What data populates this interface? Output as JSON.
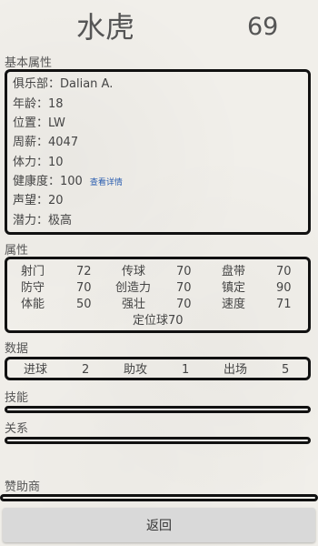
{
  "header": {
    "name": "水虎",
    "rating": "69"
  },
  "basic": {
    "title": "基本属性",
    "club": "俱乐部：Dalian A.",
    "age": "年龄：18",
    "position": "位置：LW",
    "wage": "周薪：4047",
    "stamina": "体力：10",
    "health": "健康度：100",
    "health_link": "查看详情",
    "reputation": "声望：20",
    "potential": "潜力：极高"
  },
  "attributes": {
    "title": "属性",
    "shooting_label": "射门",
    "shooting_value": "72",
    "passing_label": "传球",
    "passing_value": "70",
    "dribbling_label": "盘带",
    "dribbling_value": "70",
    "defending_label": "防守",
    "defending_value": "70",
    "creativity_label": "创造力",
    "creativity_value": "70",
    "composure_label": "镇定",
    "composure_value": "90",
    "fitness_label": "体能",
    "fitness_value": "50",
    "strength_label": "强壮",
    "strength_value": "70",
    "speed_label": "速度",
    "speed_value": "71",
    "setpiece": "定位球70"
  },
  "stats": {
    "title": "数据",
    "goals_label": "进球",
    "goals_value": "2",
    "assists_label": "助攻",
    "assists_value": "1",
    "apps_label": "出场",
    "apps_value": "5"
  },
  "skills": {
    "title": "技能"
  },
  "relations": {
    "title": "关系"
  },
  "sponsors": {
    "title": "赞助商"
  },
  "footer": {
    "back_label": "返回"
  }
}
